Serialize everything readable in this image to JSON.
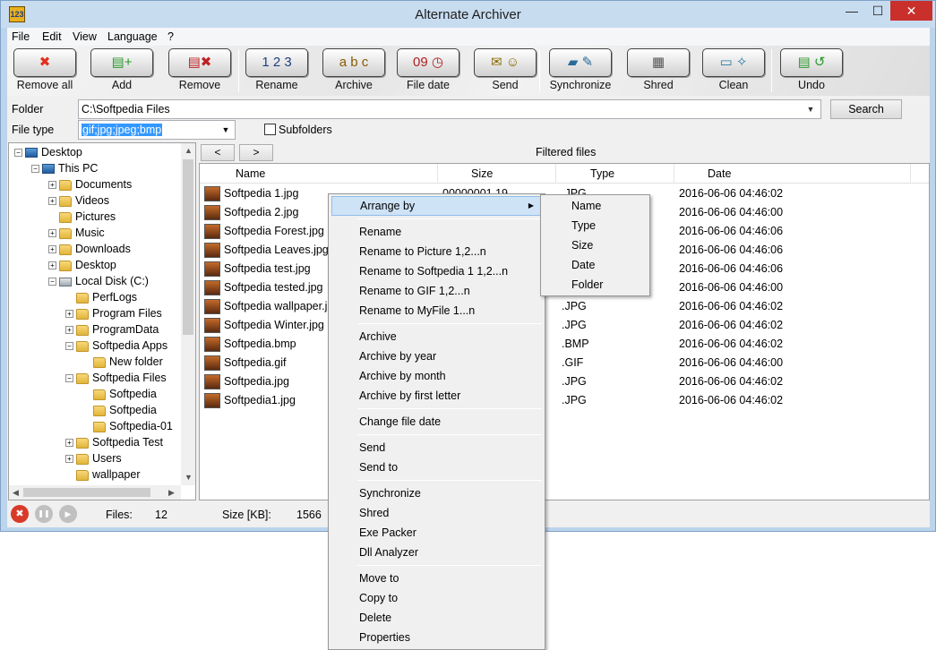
{
  "window": {
    "title": "Alternate Archiver",
    "app_icon": "123",
    "min": "—",
    "max": "☐",
    "close": "✕"
  },
  "menu": [
    "File",
    "Edit",
    "View",
    "Language",
    "?"
  ],
  "toolbar": [
    {
      "label": "Remove all",
      "icon": "remove-all-icon",
      "glyph": "✖",
      "color": "#e03020"
    },
    {
      "label": "Add",
      "icon": "add-icon",
      "glyph": "▤+",
      "color": "#2a9a2a"
    },
    {
      "label": "Remove",
      "icon": "remove-icon",
      "glyph": "▤✖",
      "color": "#c02020"
    },
    {
      "label": "Rename",
      "icon": "rename-icon",
      "glyph": "1 2 3",
      "color": "#204080"
    },
    {
      "label": "Archive",
      "icon": "archive-icon",
      "glyph": "a b c",
      "color": "#8a5a00"
    },
    {
      "label": "File date",
      "icon": "file-date-icon",
      "glyph": "09 ◷",
      "color": "#b02020"
    },
    {
      "label": "Send",
      "icon": "send-icon",
      "glyph": "✉ ☺",
      "color": "#8a6a00"
    },
    {
      "label": "Synchronize",
      "icon": "synchronize-icon",
      "glyph": "▰ ✎",
      "color": "#2a6a9a"
    },
    {
      "label": "Shred",
      "icon": "shred-icon",
      "glyph": "▦",
      "color": "#555555"
    },
    {
      "label": "Clean",
      "icon": "clean-icon",
      "glyph": "▭ ✧",
      "color": "#2a7aa0"
    },
    {
      "label": "Undo",
      "icon": "undo-icon",
      "glyph": "▤ ↺",
      "color": "#2a9a2a"
    }
  ],
  "folder": {
    "label": "Folder",
    "value": "C:\\Softpedia Files",
    "drop": "▼"
  },
  "search_label": "Search",
  "filetype": {
    "label": "File type",
    "value": "gif;jpg;jpeg;bmp",
    "drop": "▼"
  },
  "subfolders_label": "Subfolders",
  "tree": [
    {
      "label": "Desktop",
      "level": 0,
      "exp": "−",
      "icon": "pc"
    },
    {
      "label": "This PC",
      "level": 1,
      "exp": "−",
      "icon": "pc"
    },
    {
      "label": "Documents",
      "level": 2,
      "exp": "+",
      "icon": "folder"
    },
    {
      "label": "Videos",
      "level": 2,
      "exp": "+",
      "icon": "folder"
    },
    {
      "label": "Pictures",
      "level": 2,
      "exp": "",
      "icon": "folder"
    },
    {
      "label": "Music",
      "level": 2,
      "exp": "+",
      "icon": "folder"
    },
    {
      "label": "Downloads",
      "level": 2,
      "exp": "+",
      "icon": "folder"
    },
    {
      "label": "Desktop",
      "level": 2,
      "exp": "+",
      "icon": "folder"
    },
    {
      "label": "Local Disk (C:)",
      "level": 2,
      "exp": "−",
      "icon": "disk"
    },
    {
      "label": "PerfLogs",
      "level": 3,
      "exp": "",
      "icon": "folder"
    },
    {
      "label": "Program Files",
      "level": 3,
      "exp": "+",
      "icon": "folder"
    },
    {
      "label": "ProgramData",
      "level": 3,
      "exp": "+",
      "icon": "folder"
    },
    {
      "label": "Softpedia Apps",
      "level": 3,
      "exp": "−",
      "icon": "folder"
    },
    {
      "label": "New folder",
      "level": 4,
      "exp": "",
      "icon": "folder"
    },
    {
      "label": "Softpedia Files",
      "level": 3,
      "exp": "−",
      "icon": "folder"
    },
    {
      "label": "Softpedia",
      "level": 4,
      "exp": "",
      "icon": "folder"
    },
    {
      "label": "Softpedia",
      "level": 4,
      "exp": "",
      "icon": "folder"
    },
    {
      "label": "Softpedia-01",
      "level": 4,
      "exp": "",
      "icon": "folder"
    },
    {
      "label": "Softpedia Test",
      "level": 3,
      "exp": "+",
      "icon": "folder"
    },
    {
      "label": "Users",
      "level": 3,
      "exp": "+",
      "icon": "folder"
    },
    {
      "label": "wallpaper",
      "level": 3,
      "exp": "",
      "icon": "folder"
    }
  ],
  "nav": {
    "prev": "<",
    "next": ">"
  },
  "filtered_label": "Filtered files",
  "columns": [
    "Name",
    "Size",
    "Type",
    "Date"
  ],
  "files": [
    {
      "name": "Softpedia 1.jpg",
      "size": "00000001,19",
      "type": ".JPG",
      "date": "2016-06-06 04:46:02"
    },
    {
      "name": "Softpedia 2.jpg",
      "size": "",
      "type": "",
      "date": "2016-06-06 04:46:00"
    },
    {
      "name": "Softpedia Forest.jpg",
      "size": "",
      "type": "",
      "date": "2016-06-06 04:46:06"
    },
    {
      "name": "Softpedia Leaves.jpg",
      "size": "",
      "type": "",
      "date": "2016-06-06 04:46:06"
    },
    {
      "name": "Softpedia test.jpg",
      "size": "",
      "type": "",
      "date": "2016-06-06 04:46:06"
    },
    {
      "name": "Softpedia tested.jpg",
      "size": "",
      "type": "",
      "date": "2016-06-06 04:46:00"
    },
    {
      "name": "Softpedia wallpaper.jpg",
      "size": "",
      "type": ".JPG",
      "date": "2016-06-06 04:46:02"
    },
    {
      "name": "Softpedia Winter.jpg",
      "size": "",
      "type": ".JPG",
      "date": "2016-06-06 04:46:02"
    },
    {
      "name": "Softpedia.bmp",
      "size": "",
      "type": ".BMP",
      "date": "2016-06-06 04:46:02"
    },
    {
      "name": "Softpedia.gif",
      "size": "",
      "type": ".GIF",
      "date": "2016-06-06 04:46:00"
    },
    {
      "name": "Softpedia.jpg",
      "size": "",
      "type": ".JPG",
      "date": "2016-06-06 04:46:02"
    },
    {
      "name": "Softpedia1.jpg",
      "size": "",
      "type": ".JPG",
      "date": "2016-06-06 04:46:02"
    }
  ],
  "status": {
    "stop": "✖",
    "pause": "❚❚",
    "play": "▶",
    "files_label": "Files:",
    "files_value": "12",
    "size_label": "Size [KB]:",
    "size_value": "1566"
  },
  "context_menu": {
    "arrow": "▶",
    "groups": [
      [
        "Arrange by"
      ],
      [
        "Rename",
        "Rename to Picture 1,2...n",
        "Rename to Softpedia 1 1,2...n",
        "Rename to GIF 1,2...n",
        "Rename to MyFile 1...n"
      ],
      [
        "Archive",
        "Archive by year",
        "Archive by month",
        "Archive by first letter"
      ],
      [
        "Change file date"
      ],
      [
        "Send",
        "Send to"
      ],
      [
        "Synchronize",
        "Shred",
        "Exe Packer",
        "Dll Analyzer"
      ],
      [
        "Move to",
        "Copy to",
        "Delete",
        "Properties"
      ]
    ]
  },
  "submenu": [
    "Name",
    "Type",
    "Size",
    "Date",
    "Folder"
  ]
}
